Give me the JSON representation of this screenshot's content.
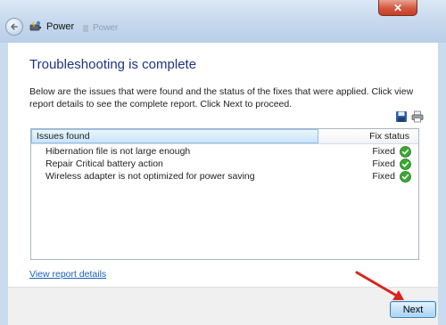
{
  "window": {
    "title": "Power",
    "ghost_tab_label": "Power",
    "close_glyph": "✕"
  },
  "page": {
    "heading": "Troubleshooting is complete",
    "description": "Below are the issues that were found and the status of the fixes that were applied. Click view report details to see the complete report. Click Next to proceed."
  },
  "issues": {
    "header_issues": "Issues found",
    "header_status": "Fix status",
    "rows": [
      {
        "issue": "Hibernation file is not large enough",
        "status": "Fixed"
      },
      {
        "issue": "Repair Critical battery action",
        "status": "Fixed"
      },
      {
        "issue": "Wireless adapter is not optimized for power saving",
        "status": "Fixed"
      }
    ]
  },
  "links": {
    "view_report": "View report details"
  },
  "footer": {
    "next_label": "Next"
  },
  "colors": {
    "heading": "#1e3287",
    "link": "#1a5fbd",
    "check_green": "#3aa832",
    "annotation_arrow": "#d8241c"
  },
  "icons": {
    "back": "back-arrow-icon",
    "app": "power-icon",
    "save": "save-icon",
    "print": "print-icon",
    "status": "check-icon"
  }
}
